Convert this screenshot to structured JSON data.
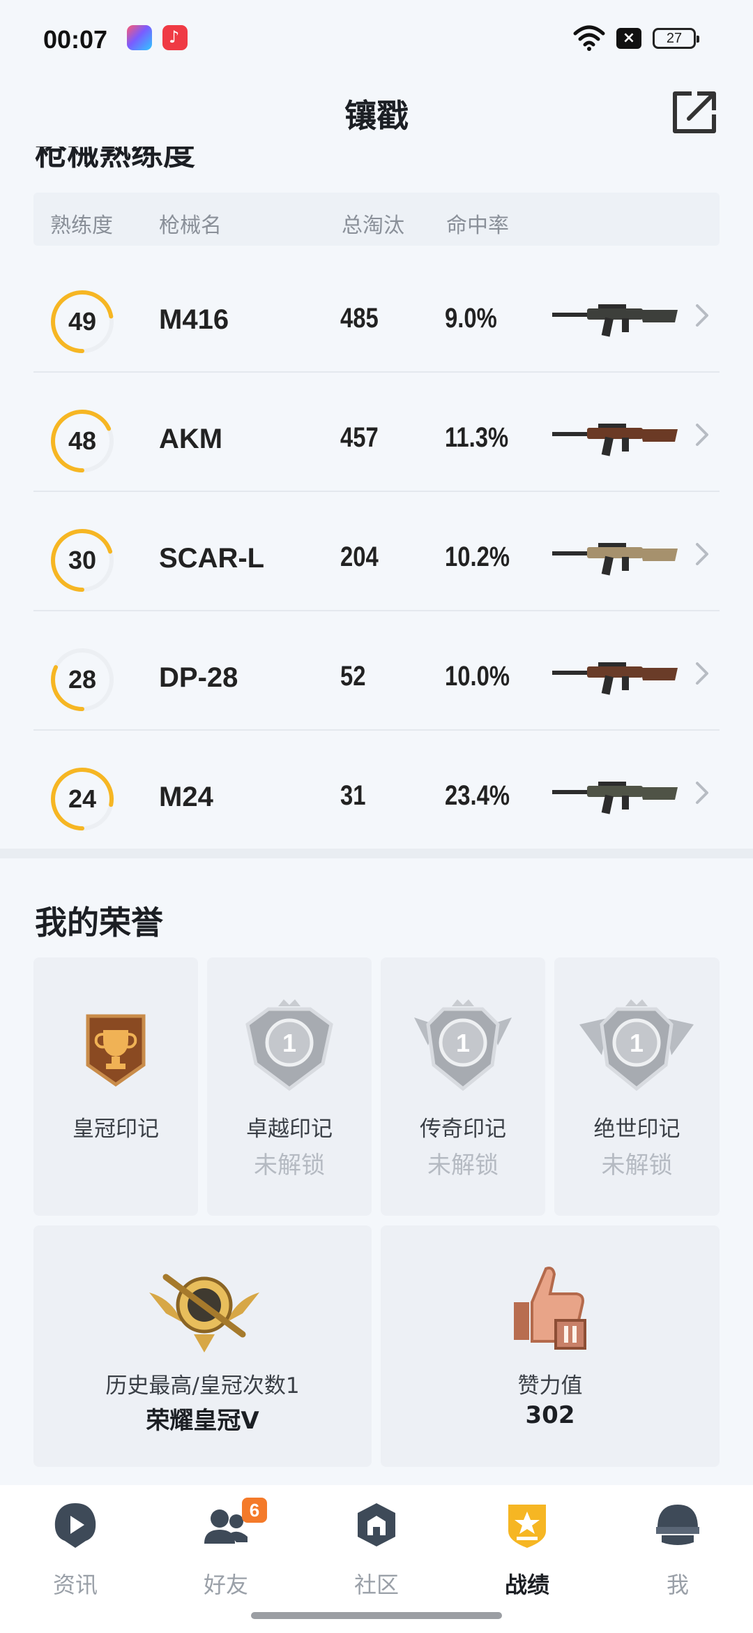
{
  "status_bar": {
    "time": "00:07",
    "battery": "27",
    "icons": [
      "photos-app-icon",
      "music-app-icon",
      "wifi-icon",
      "no-sim-icon",
      "battery-icon"
    ]
  },
  "header": {
    "title": "镶戳",
    "share_icon": "share-external-icon",
    "cut_section_title": "枪械熟练度"
  },
  "weapon_table": {
    "columns": {
      "proficiency": "熟练度",
      "name": "枪械名",
      "kills": "总淘汰",
      "accuracy": "命中率"
    },
    "rows": [
      {
        "proficiency": "49",
        "progress": 0.72,
        "name": "M416",
        "kills": "485",
        "accuracy": "9.0%",
        "gun_color": "#3d3f3b"
      },
      {
        "proficiency": "48",
        "progress": 0.68,
        "name": "AKM",
        "kills": "457",
        "accuracy": "11.3%",
        "gun_color": "#6b3a25"
      },
      {
        "proficiency": "30",
        "progress": 0.7,
        "name": "SCAR-L",
        "kills": "204",
        "accuracy": "10.2%",
        "gun_color": "#a6916d"
      },
      {
        "proficiency": "28",
        "progress": 0.32,
        "name": "DP-28",
        "kills": "52",
        "accuracy": "10.0%",
        "gun_color": "#6a3c28"
      },
      {
        "proficiency": "24",
        "progress": 0.78,
        "name": "M24",
        "kills": "31",
        "accuracy": "23.4%",
        "gun_color": "#4f5346"
      }
    ]
  },
  "honors": {
    "title": "我的荣誉",
    "marks": [
      {
        "label": "皇冠印记",
        "status": "",
        "icon": "crown-trophy-badge-icon"
      },
      {
        "label": "卓越印记",
        "status": "未解锁",
        "icon": "excellence-badge-icon"
      },
      {
        "label": "传奇印记",
        "status": "未解锁",
        "icon": "legend-badge-icon"
      },
      {
        "label": "绝世印记",
        "status": "未解锁",
        "icon": "peerless-badge-icon"
      }
    ],
    "rank": {
      "label": "历史最高/皇冠次数1",
      "value": "荣耀皇冠V",
      "icon": "crown-rank-emblem-icon"
    },
    "likes": {
      "label": "赞力值",
      "value": "302",
      "icon": "thumbs-up-trophy-icon"
    }
  },
  "bottom_nav": [
    {
      "label": "资讯",
      "icon": "news-play-icon",
      "badge": ""
    },
    {
      "label": "好友",
      "icon": "friends-icon",
      "badge": "6"
    },
    {
      "label": "社区",
      "icon": "community-icon",
      "badge": ""
    },
    {
      "label": "战绩",
      "icon": "stats-shield-icon",
      "badge": "",
      "active": true
    },
    {
      "label": "我",
      "icon": "helmet-profile-icon",
      "badge": ""
    }
  ],
  "colors": {
    "accent": "#f6b623",
    "ring_track": "#eceff3",
    "background": "#f4f7fb",
    "badge": "#f47a2a"
  }
}
